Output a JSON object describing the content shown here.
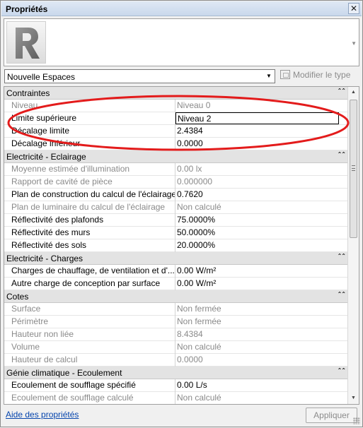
{
  "window": {
    "title": "Propriétés",
    "close_glyph": "✕"
  },
  "type_selector": {
    "logo_letter": "R",
    "logo_icon": "revit-logo-icon",
    "type_name": "Nouvelle Espaces",
    "edit_type_label": "Modifier le type"
  },
  "groups": [
    {
      "name": "Contraintes",
      "rows": [
        {
          "name": "Niveau",
          "value": "Niveau 0",
          "readonly": true
        },
        {
          "name": "Limite supérieure",
          "value": "Niveau 2",
          "readonly": false,
          "editing": true
        },
        {
          "name": "Décalage limite",
          "value": "2.4384",
          "readonly": false
        },
        {
          "name": "Décalage inférieur",
          "value": "0.0000",
          "readonly": false
        }
      ]
    },
    {
      "name": "Electricité - Eclairage",
      "rows": [
        {
          "name": "Moyenne estimée d'illumination",
          "value": "0.00 lx",
          "readonly": true
        },
        {
          "name": "Rapport de cavité de pièce",
          "value": "0.000000",
          "readonly": true
        },
        {
          "name": "Plan de construction du calcul de l'éclairage",
          "value": "0.7620",
          "readonly": false
        },
        {
          "name": "Plan de luminaire du calcul de l'éclairage",
          "value": "Non calculé",
          "readonly": true
        },
        {
          "name": "Réflectivité des plafonds",
          "value": "75.0000%",
          "readonly": false
        },
        {
          "name": "Réflectivité des murs",
          "value": "50.0000%",
          "readonly": false
        },
        {
          "name": "Réflectivité des sols",
          "value": "20.0000%",
          "readonly": false
        }
      ]
    },
    {
      "name": "Electricité - Charges",
      "rows": [
        {
          "name": "Charges de chauffage, de ventilation et d'...",
          "value": "0.00 W/m²",
          "readonly": false
        },
        {
          "name": "Autre charge de conception par surface",
          "value": "0.00 W/m²",
          "readonly": false
        }
      ]
    },
    {
      "name": "Cotes",
      "rows": [
        {
          "name": "Surface",
          "value": "Non fermée",
          "readonly": true
        },
        {
          "name": "Périmètre",
          "value": "Non fermée",
          "readonly": true
        },
        {
          "name": "Hauteur non liée",
          "value": "8.4384",
          "readonly": true
        },
        {
          "name": "Volume",
          "value": "Non calculé",
          "readonly": true
        },
        {
          "name": "Hauteur de calcul",
          "value": "0.0000",
          "readonly": true
        }
      ]
    },
    {
      "name": "Génie climatique - Ecoulement",
      "rows": [
        {
          "name": "Ecoulement de soufflage spécifié",
          "value": "0.00 L/s",
          "readonly": false
        },
        {
          "name": "Ecoulement de soufflage calculé",
          "value": "Non calculé",
          "readonly": true
        }
      ]
    }
  ],
  "footer": {
    "help_link": "Aide des propriétés",
    "apply_label": "Appliquer"
  },
  "colors": {
    "annotation_ellipse": "#e31b1b",
    "readonly_text": "#8a8a8a",
    "group_header_bg": "#e3e3e3"
  }
}
